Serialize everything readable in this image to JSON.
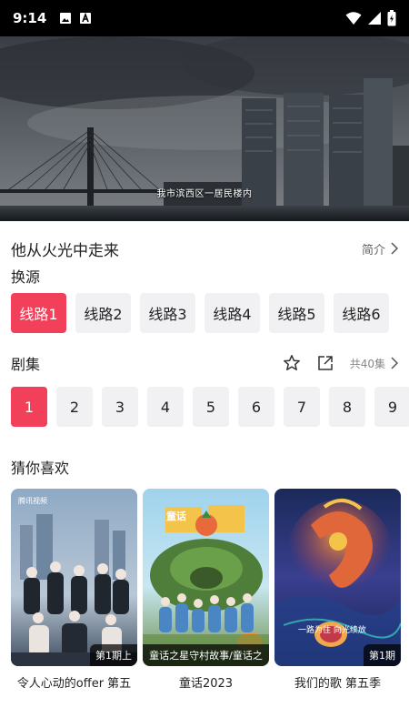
{
  "status_bar": {
    "time": "9:14",
    "left_icons": [
      "image-icon",
      "text-icon"
    ],
    "right_icons": [
      "wifi-icon",
      "cell-signal-icon",
      "battery-icon"
    ]
  },
  "video": {
    "subtitle": "我市滨西区一居民楼内"
  },
  "show": {
    "title": "他从火光中走来",
    "intro_label": "简介"
  },
  "sources": {
    "heading": "换源",
    "items": [
      "线路1",
      "线路2",
      "线路3",
      "线路4",
      "线路5",
      "线路6"
    ],
    "active_index": 0
  },
  "episodes": {
    "heading": "剧集",
    "count_label": "共40集",
    "items": [
      "1",
      "2",
      "3",
      "4",
      "5",
      "6",
      "7",
      "8",
      "9"
    ],
    "active_index": 0
  },
  "recommend": {
    "heading": "猜你喜欢",
    "items": [
      {
        "title": "令人心动的offer 第五",
        "badge": "第1期上",
        "poster_tag": "腾讯视频"
      },
      {
        "title": "童话2023",
        "badge": "童话之星守村故事/童话之",
        "poster_tag": "童话"
      },
      {
        "title": "我们的歌 第五季",
        "badge": "第1期",
        "poster_tag": "一路为往 向光续放"
      }
    ]
  },
  "colors": {
    "accent": "#f2405a",
    "chip_bg": "#f1f1f3",
    "status_bar_bg": "#000000"
  }
}
